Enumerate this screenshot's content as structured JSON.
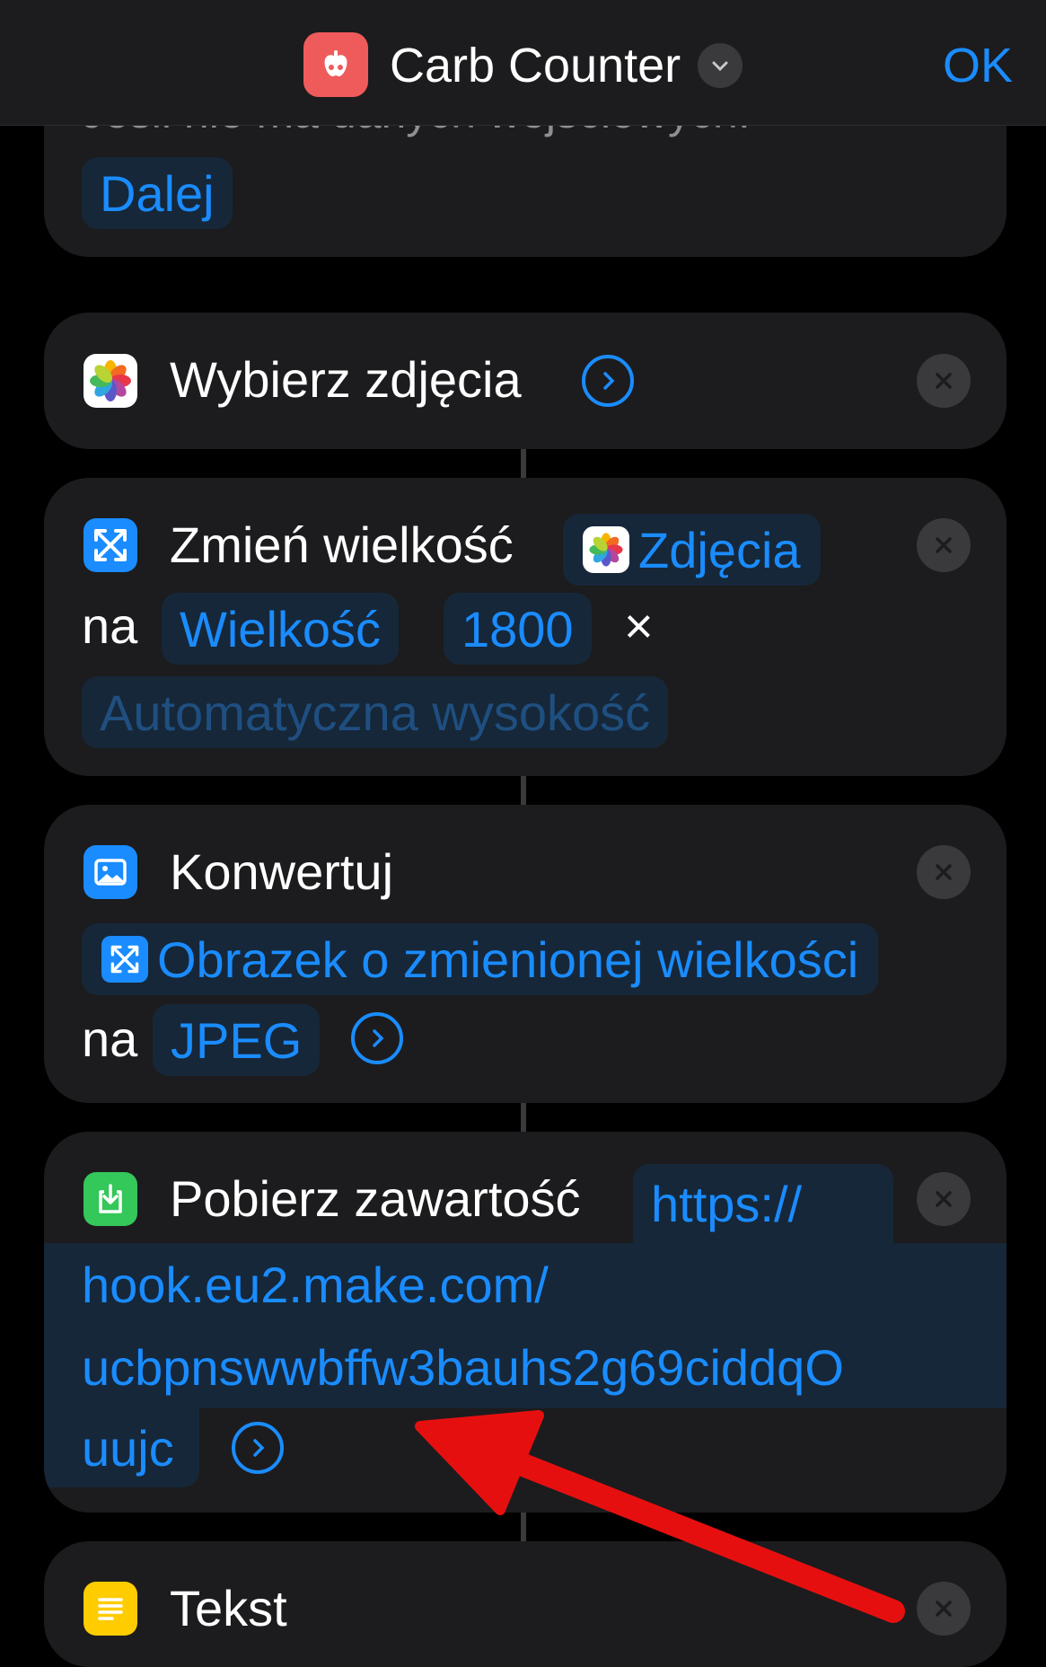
{
  "header": {
    "title": "Carb Counter",
    "ok_label": "OK",
    "app_icon_color": "#ef5b5b"
  },
  "card0": {
    "faded_text": "Jeśli nie ma danych wejściowych:",
    "token": "Dalej"
  },
  "card1": {
    "title": "Wybierz zdjęcia"
  },
  "card2": {
    "title": "Zmień wielkość",
    "token_photos": "Zdjęcia",
    "na": "na",
    "token_size": "Wielkość",
    "token_width": "1800",
    "times": "×",
    "token_height": "Automatyczna wysokość"
  },
  "card3": {
    "title": "Konwertuj",
    "token_image": "Obrazek o zmienionej wielkości",
    "na": "na",
    "token_format": "JPEG"
  },
  "card4": {
    "title": "Pobierz zawartość",
    "url_part1": "https://",
    "url_part2": "hook.eu2.make.com/",
    "url_part3": "ucbpnswwbffw3bauhs2g69ciddqO",
    "url_part4": "uujc"
  },
  "card5": {
    "title": "Tekst"
  },
  "colors": {
    "accent": "#1a8cff",
    "annotation_arrow": "#e60f0f"
  }
}
